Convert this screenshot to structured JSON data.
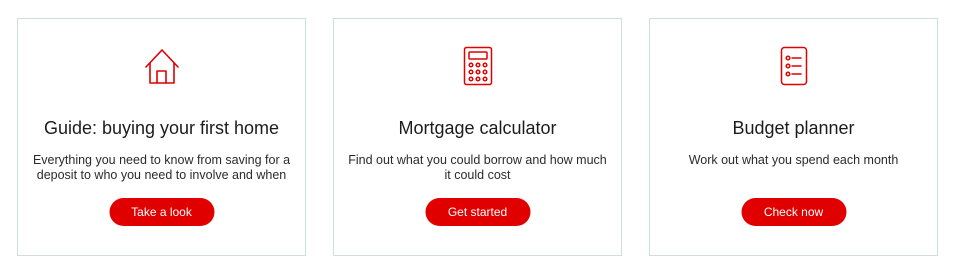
{
  "cards": [
    {
      "icon": "house-icon",
      "title": "Guide: buying your first home",
      "description": "Everything you need to know from saving for a deposit to who you need to involve and when",
      "button_label": "Take a look"
    },
    {
      "icon": "calculator-icon",
      "title": "Mortgage calculator",
      "description": "Find out what you could borrow and how much it could cost",
      "button_label": "Get started"
    },
    {
      "icon": "checklist-icon",
      "title": "Budget planner",
      "description": "Work out what you spend each month",
      "button_label": "Check now"
    }
  ],
  "colors": {
    "accent": "#e00000",
    "border": "#cfdedf",
    "text": "#222222"
  }
}
